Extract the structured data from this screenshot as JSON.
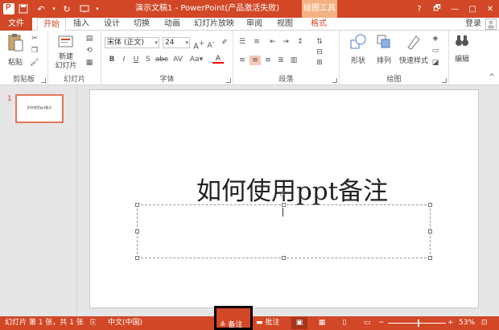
{
  "window": {
    "title": "演示文稿1 - PowerPoint(产品激活失败)",
    "contextual_tab": "绘图工具",
    "controls": [
      "?",
      "🗗",
      "—",
      "□",
      "✕"
    ]
  },
  "tabs": {
    "file": "文件",
    "items": [
      "开始",
      "插入",
      "设计",
      "切换",
      "动画",
      "幻灯片放映",
      "审阅",
      "视图",
      "格式"
    ],
    "signin": "登录"
  },
  "ribbon": {
    "clipboard": {
      "label": "剪贴板",
      "paste": "粘贴"
    },
    "slides": {
      "label": "幻灯片",
      "new_slide": "新建\n幻灯片"
    },
    "font": {
      "label": "字体",
      "font_name": "宋体 (正文)",
      "font_size": "24"
    },
    "paragraph": {
      "label": "段落"
    },
    "drawing": {
      "label": "绘图",
      "shapes": "形状",
      "arrange": "排列",
      "quick_styles": "快速样式"
    },
    "editing": {
      "label": "编辑"
    }
  },
  "thumbnails": {
    "number": "1",
    "text": "如何使用ppt备注"
  },
  "slide": {
    "title": "如何使用ppt备注"
  },
  "status": {
    "slide_info": "幻灯片 第 1 张，共 1 张",
    "language": "中文(中国)",
    "notes": "备注",
    "comments": "批注",
    "zoom": "53%"
  },
  "colors": {
    "accent": "#d24726",
    "contextual": "#f4b183"
  }
}
